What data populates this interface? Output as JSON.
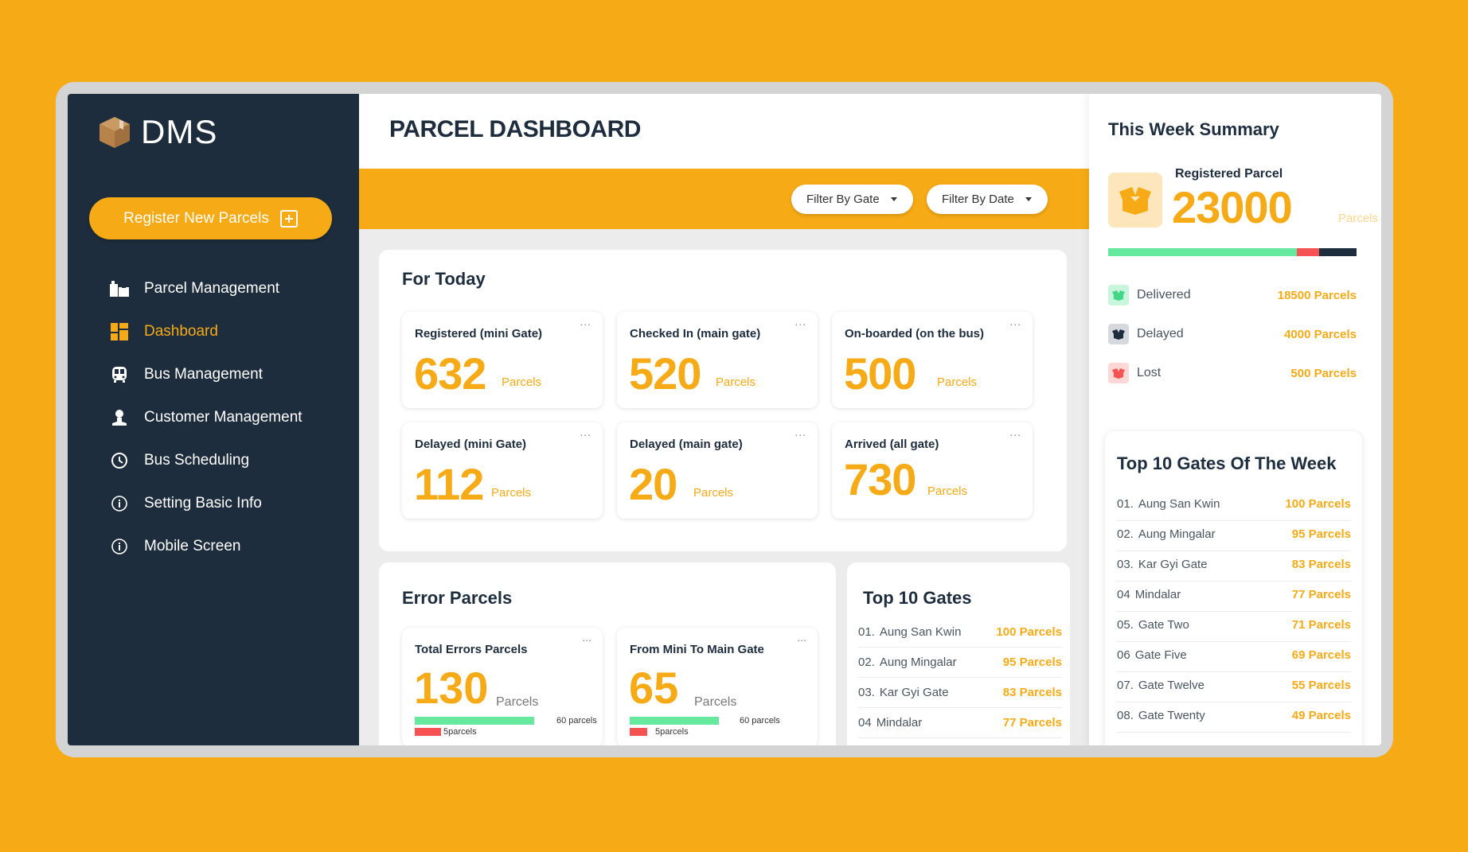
{
  "app": {
    "logo_text": "DMS",
    "logo_icon": "parcel-box-icon",
    "colors": {
      "accent": "#f5aa16",
      "sidebar": "#1e2d3d",
      "green": "#66e99f",
      "red": "#f55353",
      "dark": "#1e2d3d"
    }
  },
  "sidebar": {
    "register_button": "Register New Parcels",
    "items": [
      {
        "label": "Parcel Management",
        "icon": "parcels-icon",
        "active": false
      },
      {
        "label": "Dashboard",
        "icon": "dashboard-icon",
        "active": true
      },
      {
        "label": "Bus Management",
        "icon": "bus-icon",
        "active": false
      },
      {
        "label": "Customer Management",
        "icon": "user-icon",
        "active": false
      },
      {
        "label": "Bus Scheduling",
        "icon": "clock-icon",
        "active": false
      },
      {
        "label": "Setting Basic Info",
        "icon": "info-icon",
        "active": false
      },
      {
        "label": "Mobile Screen",
        "icon": "info-icon",
        "active": false
      }
    ]
  },
  "header": {
    "title": "PARCEL DASHBOARD",
    "filters": [
      {
        "label": "Filter By Gate"
      },
      {
        "label": "Filter By Date"
      }
    ]
  },
  "today": {
    "title": "For Today",
    "cards": [
      {
        "label": "Registered (mini Gate)",
        "value": "632",
        "unit": "Parcels"
      },
      {
        "label": "Checked In (main gate)",
        "value": "520",
        "unit": "Parcels"
      },
      {
        "label": "On-boarded (on the bus)",
        "value": "500",
        "unit": "Parcels"
      },
      {
        "label": "Delayed (mini Gate)",
        "value": "112",
        "unit": "Parcels"
      },
      {
        "label": "Delayed (main gate)",
        "value": "20",
        "unit": "Parcels"
      },
      {
        "label": "Arrived (all gate)",
        "value": "730",
        "unit": "Parcels"
      }
    ],
    "more_label": "..."
  },
  "errors": {
    "title": "Error Parcels",
    "cards": [
      {
        "label": "Total Errors Parcels",
        "value": "130",
        "unit": "Parcels",
        "green_label": "60 parcels",
        "green_value": 60,
        "red_label": "5parcels",
        "red_value": 5
      },
      {
        "label": "From Mini To Main Gate",
        "value": "65",
        "unit": "Parcels",
        "green_label": "60 parcels",
        "green_value": 60,
        "red_label": "5parcels",
        "red_value": 5
      }
    ]
  },
  "top_gates": {
    "title": "Top 10 Gates",
    "rows": [
      {
        "rank": "01.",
        "name": "Aung San Kwin",
        "value": "100 Parcels"
      },
      {
        "rank": "02.",
        "name": "Aung Mingalar",
        "value": "95 Parcels"
      },
      {
        "rank": "03.",
        "name": "Kar Gyi Gate",
        "value": "83 Parcels"
      },
      {
        "rank": "04",
        "name": "Mindalar",
        "value": "77 Parcels"
      }
    ]
  },
  "week_summary": {
    "title": "This Week Summary",
    "registered_label": "Registered Parcel",
    "registered_value": "23000",
    "registered_unit": "Parcels",
    "breakdown": [
      {
        "label": "Delivered",
        "value": "18500 Parcels",
        "count": 18500,
        "color": "#66e99f",
        "chip_bg": "#c8f6dc",
        "icon": "delivered-box-icon"
      },
      {
        "label": "Delayed",
        "value": "4000 Parcels",
        "count": 4000,
        "color": "#1e2d3d",
        "chip_bg": "#d5d9de",
        "icon": "delayed-box-icon"
      },
      {
        "label": "Lost",
        "value": "500 Parcels",
        "count": 500,
        "color": "#f55353",
        "chip_bg": "#fdd6d6",
        "icon": "lost-box-icon"
      }
    ],
    "bar_segments": [
      {
        "name": "delivered",
        "fraction": 0.76,
        "color": "#66e99f"
      },
      {
        "name": "lost",
        "fraction": 0.09,
        "color": "#f55353"
      },
      {
        "name": "delayed",
        "fraction": 0.15,
        "color": "#1e2d3d"
      }
    ]
  },
  "top_gates_week": {
    "title": "Top 10 Gates Of The Week",
    "rows": [
      {
        "rank": "01.",
        "name": "Aung San Kwin",
        "value": "100 Parcels"
      },
      {
        "rank": "02.",
        "name": "Aung Mingalar",
        "value": "95 Parcels"
      },
      {
        "rank": "03.",
        "name": "Kar Gyi Gate",
        "value": "83 Parcels"
      },
      {
        "rank": "04",
        "name": "Mindalar",
        "value": "77 Parcels"
      },
      {
        "rank": "05.",
        "name": "Gate Two",
        "value": "71 Parcels"
      },
      {
        "rank": "06",
        "name": "Gate Five",
        "value": "69 Parcels"
      },
      {
        "rank": "07.",
        "name": "Gate Twelve",
        "value": "55 Parcels"
      },
      {
        "rank": "08.",
        "name": "Gate Twenty",
        "value": "49 Parcels"
      }
    ]
  }
}
